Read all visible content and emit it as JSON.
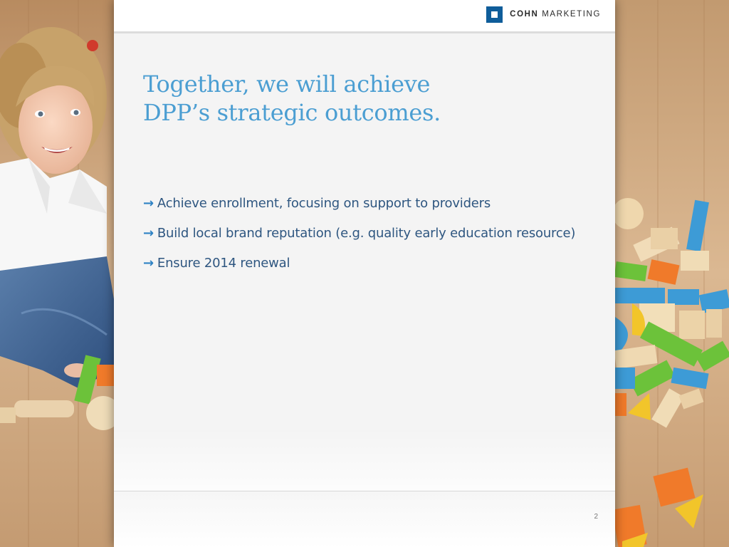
{
  "brand": {
    "logo_bold": "COHN",
    "logo_regular": "MARKETING",
    "logo_color": "#0f5d9a"
  },
  "slide": {
    "title_line1": "Together, we will achieve",
    "title_line2": "DPP’s strategic outcomes.",
    "title_color": "#4b9ed2",
    "bullet_arrow": "→",
    "bullets": [
      "Achieve enrollment, focusing on support to providers",
      "Build local brand reputation (e.g. quality early education resource)",
      "Ensure 2014 renewal"
    ],
    "text_color": "#2e5680",
    "page_number": "2"
  },
  "background": {
    "left_image": "child-sitting-on-wood-floor-photo",
    "right_image": "wooden-toy-blocks-photo"
  }
}
